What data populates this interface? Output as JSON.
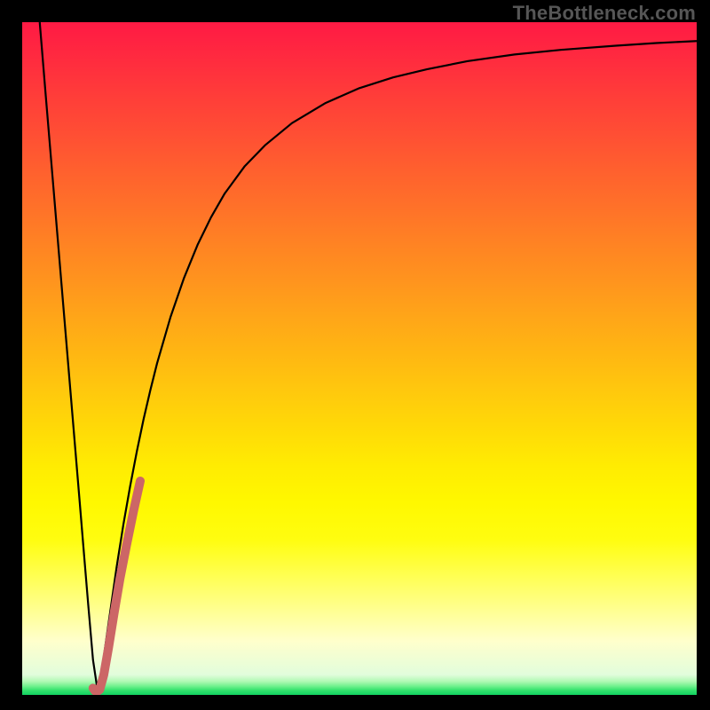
{
  "watermark": "TheBottleneck.com",
  "layout": {
    "outer_w": 800,
    "outer_h": 800,
    "margin_left": 25,
    "margin_right": 15,
    "margin_top": 25,
    "margin_bottom": 17
  },
  "gradient": {
    "stops": [
      {
        "offset": 0.0,
        "color": "#ff1a44"
      },
      {
        "offset": 0.055,
        "color": "#ff2b3f"
      },
      {
        "offset": 0.11,
        "color": "#ff3d39"
      },
      {
        "offset": 0.165,
        "color": "#ff4e34"
      },
      {
        "offset": 0.22,
        "color": "#ff602e"
      },
      {
        "offset": 0.275,
        "color": "#ff7129"
      },
      {
        "offset": 0.33,
        "color": "#ff8323"
      },
      {
        "offset": 0.385,
        "color": "#ff941e"
      },
      {
        "offset": 0.44,
        "color": "#ffa618"
      },
      {
        "offset": 0.495,
        "color": "#ffb712"
      },
      {
        "offset": 0.55,
        "color": "#ffc90d"
      },
      {
        "offset": 0.605,
        "color": "#ffda07"
      },
      {
        "offset": 0.66,
        "color": "#ffec02"
      },
      {
        "offset": 0.715,
        "color": "#fff800"
      },
      {
        "offset": 0.77,
        "color": "#fffd10"
      },
      {
        "offset": 0.825,
        "color": "#ffff55"
      },
      {
        "offset": 0.88,
        "color": "#ffff99"
      },
      {
        "offset": 0.92,
        "color": "#ffffcc"
      },
      {
        "offset": 0.97,
        "color": "#e2fddc"
      },
      {
        "offset": 0.98,
        "color": "#b0f9b4"
      },
      {
        "offset": 0.987,
        "color": "#70f18d"
      },
      {
        "offset": 0.993,
        "color": "#35e26d"
      },
      {
        "offset": 1.0,
        "color": "#11d160"
      }
    ]
  },
  "chart_data": {
    "type": "line",
    "title": "",
    "xlabel": "",
    "ylabel": "",
    "xlim": [
      0,
      100
    ],
    "ylim": [
      0,
      100
    ],
    "series": [
      {
        "name": "bottleneck-curve",
        "color": "#000000",
        "width": 2.2,
        "x": [
          2.6,
          3.5,
          4.5,
          5.5,
          6.5,
          7.5,
          8.5,
          9.2,
          9.8,
          10.5,
          11.2,
          12.0,
          13.0,
          14.0,
          15.0,
          16.0,
          17.0,
          18.0,
          19.0,
          20.0,
          22.0,
          24.0,
          26.0,
          28.0,
          30.0,
          33.0,
          36.0,
          40.0,
          45.0,
          50.0,
          55.0,
          60.0,
          66.0,
          73.0,
          80.0,
          88.0,
          94.0,
          100.0
        ],
        "y": [
          100.0,
          89.0,
          77.0,
          65.0,
          53.0,
          41.0,
          29.0,
          20.5,
          13.3,
          5.2,
          0.5,
          5.0,
          12.0,
          19.0,
          25.3,
          31.0,
          36.2,
          41.0,
          45.3,
          49.3,
          56.2,
          62.0,
          66.9,
          71.0,
          74.5,
          78.6,
          81.7,
          85.0,
          88.0,
          90.2,
          91.8,
          93.0,
          94.2,
          95.2,
          95.9,
          96.5,
          96.9,
          97.2
        ]
      },
      {
        "name": "highlight-segment",
        "color": "#cc6666",
        "width": 10,
        "linecap": "round",
        "x": [
          10.5,
          10.8,
          11.1,
          11.5,
          12.1,
          12.8,
          13.6,
          14.5,
          15.5,
          16.5,
          17.5
        ],
        "y": [
          1.0,
          0.6,
          0.5,
          0.8,
          3.0,
          7.0,
          12.0,
          17.3,
          22.4,
          27.3,
          31.8
        ]
      }
    ]
  }
}
